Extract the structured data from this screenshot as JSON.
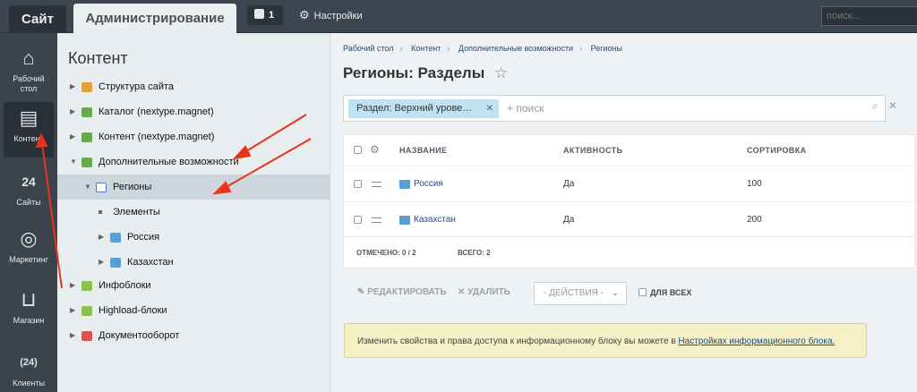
{
  "topbar": {
    "tab_site": "Сайт",
    "tab_admin": "Администрирование",
    "notifications_count": "1",
    "settings_label": "Настройки",
    "search_placeholder": "поиск..."
  },
  "sidebar": {
    "items": [
      {
        "label": "Рабочий стол",
        "icon": "home-icon"
      },
      {
        "label": "Контент",
        "icon": "document-icon"
      },
      {
        "label": "Сайты",
        "icon": "calendar-icon"
      },
      {
        "label": "Маркетинг",
        "icon": "target-icon"
      },
      {
        "label": "Магазин",
        "icon": "basket-icon"
      },
      {
        "label": "Клиенты",
        "icon": "clients-icon"
      }
    ]
  },
  "tree": {
    "title": "Контент",
    "items": [
      {
        "label": "Структура сайта"
      },
      {
        "label": "Каталог (nextype.magnet)"
      },
      {
        "label": "Контент (nextype.magnet)"
      },
      {
        "label": "Дополнительные возможности"
      },
      {
        "label": "Регионы"
      },
      {
        "label": "Элементы"
      },
      {
        "label": "Россия"
      },
      {
        "label": "Казахстан"
      },
      {
        "label": "Инфоблоки"
      },
      {
        "label": "Highload-блоки"
      },
      {
        "label": "Документооборот"
      }
    ]
  },
  "main": {
    "breadcrumbs": [
      "Рабочий стол",
      "Контент",
      "Дополнительные возможности",
      "Регионы"
    ],
    "title": "Регионы: Разделы",
    "filter": {
      "chip": "Раздел: Верхний урове…",
      "placeholder": "+ поиск"
    },
    "grid": {
      "columns": [
        "НАЗВАНИЕ",
        "АКТИВНОСТЬ",
        "СОРТИРОВКА"
      ],
      "rows": [
        {
          "name": "Россия",
          "active": "Да",
          "sort": "100"
        },
        {
          "name": "Казахстан",
          "active": "Да",
          "sort": "200"
        }
      ],
      "checked_label": "ОТМЕЧЕНО:",
      "checked_value": "0 / 2",
      "total_label": "ВСЕГО:",
      "total_value": "2"
    },
    "actions": {
      "edit": "РЕДАКТИРОВАТЬ",
      "delete": "УДАЛИТЬ",
      "select": "- ДЕЙСТВИЯ -",
      "for_all": "ДЛЯ ВСЕХ"
    },
    "notice": {
      "text": "Изменить свойства и права доступа к информационному блоку вы можете в ",
      "link": "Настройках информационного блока."
    }
  },
  "colors": {
    "annotation_arrow": "#e8341c",
    "chip": "#bfe3f3",
    "notice": "#f5f0c5"
  }
}
